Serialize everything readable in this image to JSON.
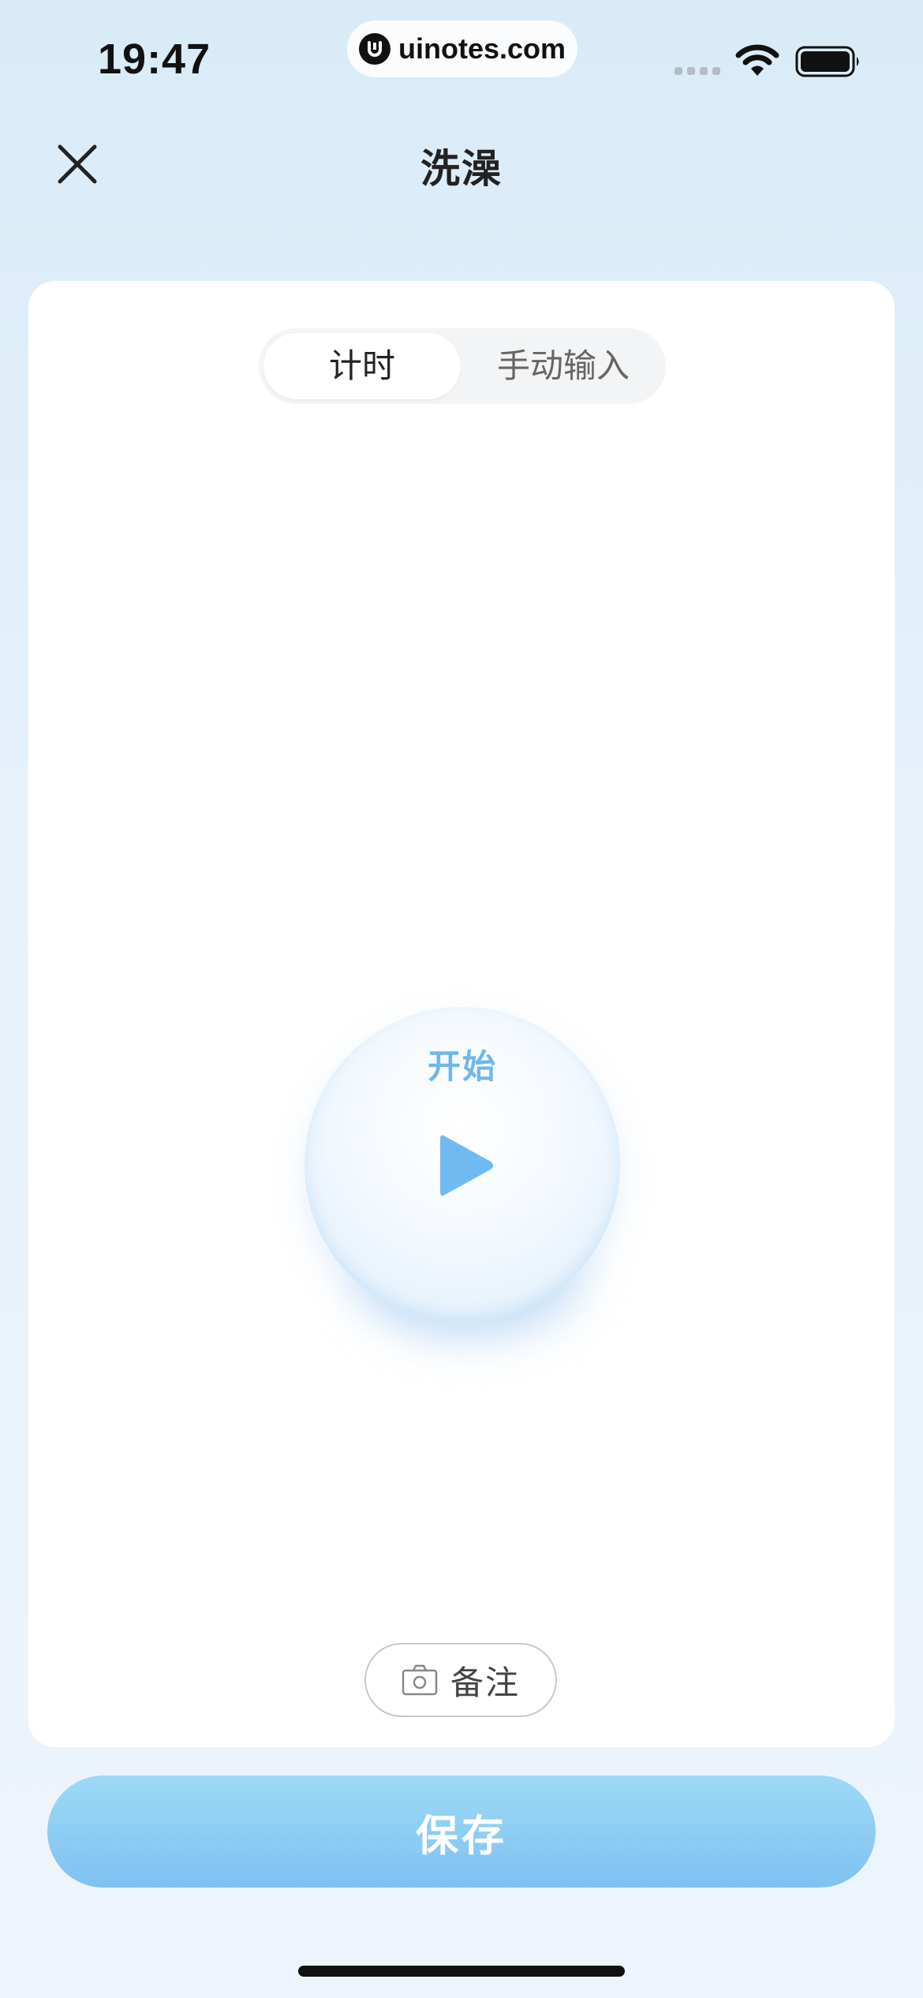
{
  "status_bar": {
    "time": "19:47",
    "url": "uinotes.com",
    "icons": [
      "signal-icon",
      "wifi-icon",
      "battery-icon"
    ]
  },
  "nav": {
    "title": "洗澡",
    "close_icon": "close-icon"
  },
  "mode_tabs": [
    {
      "label": "计时",
      "active": true
    },
    {
      "label": "手动输入",
      "active": false
    }
  ],
  "timer": {
    "start_label": "开始",
    "icon": "play-icon"
  },
  "note": {
    "label": "备注",
    "icon": "camera-icon"
  },
  "save": {
    "label": "保存"
  },
  "colors": {
    "accent": "#7ec2f2",
    "accent_light": "#9fd9f5",
    "start_text": "#6fb6ea"
  }
}
